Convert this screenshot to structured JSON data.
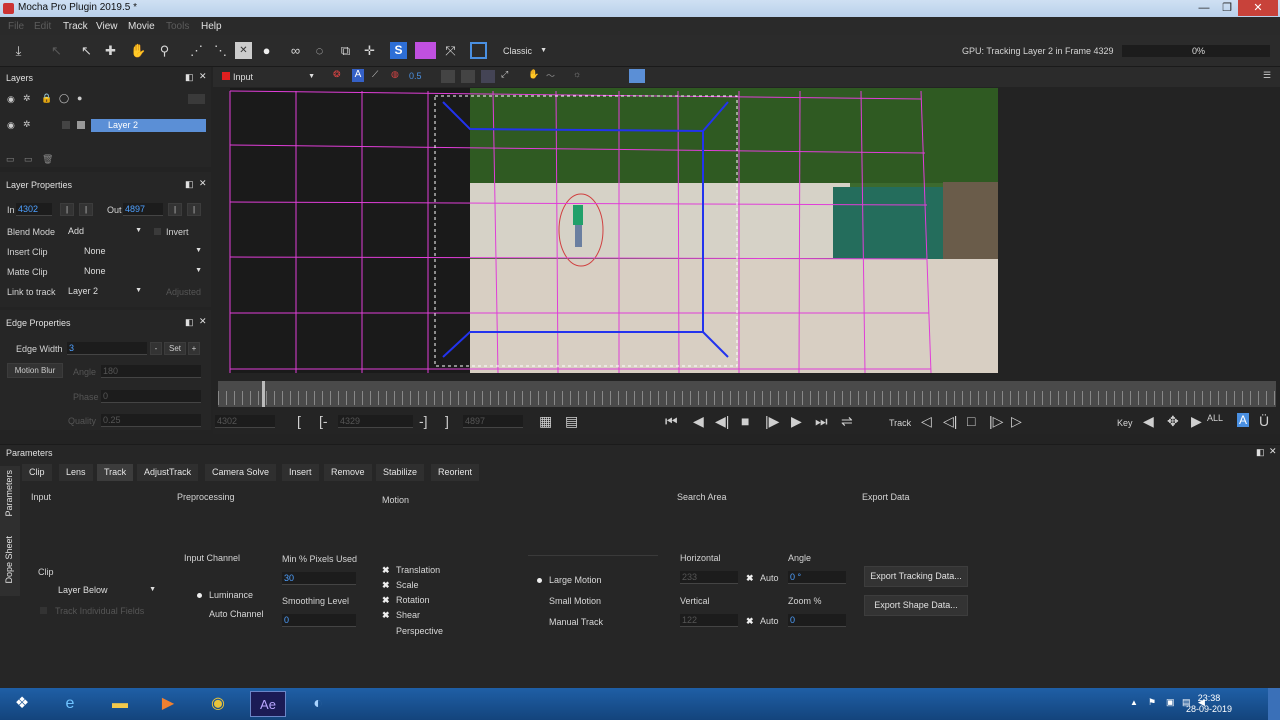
{
  "window": {
    "title": "Mocha Pro Plugin 2019.5 *",
    "min": "—",
    "max": "❐",
    "close": "✕"
  },
  "menu": [
    {
      "label": "File",
      "disabled": true
    },
    {
      "label": "Edit",
      "disabled": true
    },
    {
      "label": "Track",
      "disabled": false
    },
    {
      "label": "View",
      "disabled": false
    },
    {
      "label": "Movie",
      "disabled": false
    },
    {
      "label": "Tools",
      "disabled": true
    },
    {
      "label": "Help",
      "disabled": false
    }
  ],
  "toolbar": {
    "view_mode": "Classic",
    "gpu_status": "GPU: Tracking Layer 2 in Frame 4329",
    "progress_text": "0%",
    "progress": 0
  },
  "layers": {
    "title": "Layers",
    "items": [
      {
        "name": "Layer 2",
        "selected": true
      }
    ]
  },
  "layer_properties": {
    "title": "Layer Properties",
    "in_label": "In",
    "in_value": "4302",
    "out_label": "Out",
    "out_value": "4897",
    "blend_mode_label": "Blend Mode",
    "blend_mode": "Add",
    "invert_label": "Invert",
    "insert_clip_label": "Insert Clip",
    "insert_clip": "None",
    "matte_clip_label": "Matte Clip",
    "matte_clip": "None",
    "link_label": "Link to track",
    "link_value": "Layer 2",
    "adjusted_label": "Adjusted"
  },
  "edge_properties": {
    "title": "Edge Properties",
    "edge_width_label": "Edge Width",
    "edge_width": "3",
    "set_label": "Set",
    "motion_blur_label": "Motion Blur",
    "angle_label": "Angle",
    "angle_value": "180",
    "phase_label": "Phase",
    "phase_value": "0",
    "quality_label": "Quality",
    "quality_value": "0.25"
  },
  "viewer": {
    "clip": "Input",
    "opacity": "0.5"
  },
  "transport": {
    "frame_start": "4302",
    "frame_current": "4329",
    "frame_end": "4897",
    "track_label": "Track",
    "key_label": "Key"
  },
  "parameters": {
    "title": "Parameters",
    "side_tabs": [
      "Parameters",
      "Dope Sheet"
    ],
    "tabs": [
      "Clip",
      "Lens",
      "Track",
      "AdjustTrack",
      "Camera Solve",
      "Insert",
      "Remove",
      "Stabilize",
      "Reorient"
    ],
    "active_tab": "Track",
    "input": {
      "title": "Input",
      "clip_label": "Clip",
      "clip_value": "Layer Below",
      "track_fields_label": "Track Individual Fields"
    },
    "preprocessing": {
      "title": "Preprocessing",
      "input_channel_label": "Input Channel",
      "luminance_label": "Luminance",
      "auto_channel_label": "Auto Channel",
      "min_pixels_label": "Min % Pixels Used",
      "min_pixels_value": "30",
      "smoothing_label": "Smoothing Level",
      "smoothing_value": "0"
    },
    "motion": {
      "title": "Motion",
      "checks": [
        {
          "label": "Translation",
          "checked": true
        },
        {
          "label": "Scale",
          "checked": true
        },
        {
          "label": "Rotation",
          "checked": true
        },
        {
          "label": "Shear",
          "checked": true
        },
        {
          "label": "Perspective",
          "checked": false
        }
      ],
      "modes": [
        {
          "label": "Large Motion",
          "selected": true
        },
        {
          "label": "Small Motion",
          "selected": false
        },
        {
          "label": "Manual Track",
          "selected": false
        }
      ]
    },
    "search_area": {
      "title": "Search Area",
      "horizontal_label": "Horizontal",
      "horizontal_value": "233",
      "vertical_label": "Vertical",
      "vertical_value": "122",
      "auto_label": "Auto",
      "angle_label": "Angle",
      "angle_value": "0 °",
      "zoom_label": "Zoom %",
      "zoom_value": "0"
    },
    "export": {
      "title": "Export Data",
      "tracking_button": "Export Tracking Data...",
      "shape_button": "Export Shape Data..."
    }
  },
  "taskbar": {
    "time": "23:38",
    "date": "28-09-2019"
  },
  "colors": {
    "accent": "#4a90e2",
    "grid": "#e03ed8",
    "spline": "#2233ee",
    "selected_layer": "#5b8fd6"
  }
}
